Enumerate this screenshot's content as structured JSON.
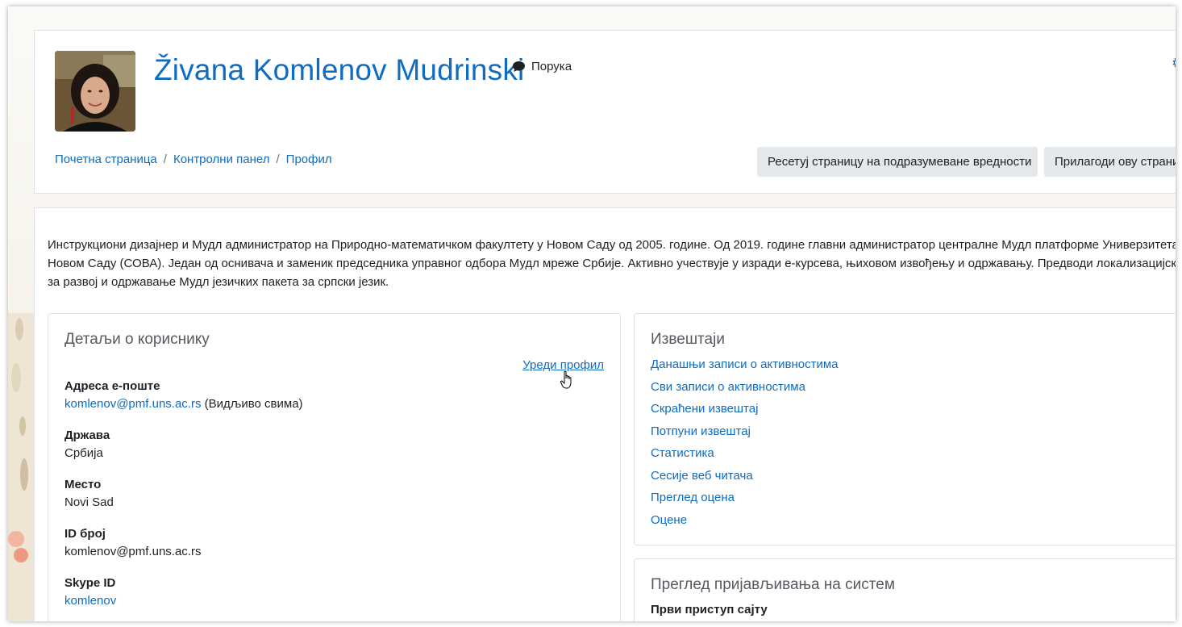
{
  "header": {
    "user_name": "Živana Komlenov Mudrinski",
    "message_label": "Порука",
    "breadcrumb": [
      "Почетна страница",
      "Контролни панел",
      "Профил"
    ],
    "breadcrumb_sep": "/",
    "reset_button": "Ресетуј страницу на подразумеване вредности",
    "customize_button": "Прилагоди ову страницу"
  },
  "description": {
    "lines": [
      "Инструкциони дизајнер и Мудл администратор на Природно-математичком факултету у Новом Саду од 2005. године. Од 2019. године главни администратор централне Мудл платформе Универзитета у",
      "Новом Саду (СОВА). Један од оснивача и заменик председника управног одбора Мудл мреже Србије. Активно учествује у изради е-курсева, њиховом извођењу и одржавању. Предводи локализацијски т",
      "за развој и одржавање Мудл језичких пакета за српски језик."
    ]
  },
  "user_details": {
    "title": "Детаљи о кориснику",
    "edit_link": "Уреди профил",
    "email_label": "Адреса е-поште",
    "email_value": "komlenov@pmf.uns.ac.rs",
    "email_visibility": "(Видљиво свима)",
    "country_label": "Држава",
    "country_value": "Србија",
    "city_label": "Место",
    "city_value": "Novi Sad",
    "id_label": "ID број",
    "id_value": "komlenov@pmf.uns.ac.rs",
    "skype_label": "Skype ID",
    "skype_value": "komlenov"
  },
  "reports": {
    "title": "Извештаји",
    "items": [
      "Данашњи записи о активностима",
      "Сви записи о активностима",
      "Скраћени извештај",
      "Потпуни извештај",
      "Статистика",
      "Сесије веб читача",
      "Преглед оцена",
      "Оцене"
    ]
  },
  "login_activity": {
    "title": "Преглед пријављивања на систем",
    "first_access_label": "Први приступ сајту"
  },
  "colors": {
    "link": "#0f6cbf",
    "border": "#dee2e6",
    "button_bg": "#e6e9ec"
  }
}
